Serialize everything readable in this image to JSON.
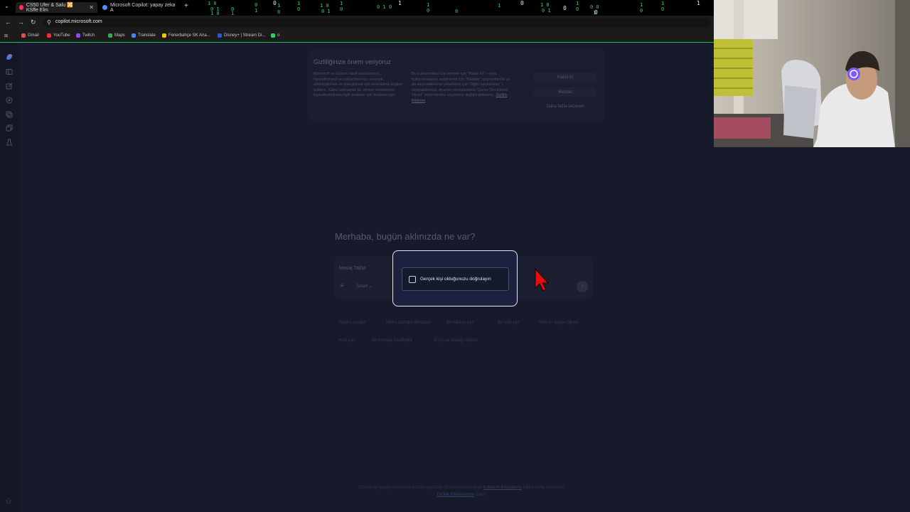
{
  "browser": {
    "tabs": [
      {
        "label": "CS50 Ufer & Salu 🔀 KSffe Elm",
        "active": true,
        "color": "#ff2d55"
      },
      {
        "label": "Microsoft Copilot: yapay zeka A",
        "active": false,
        "color": "#5b8cff"
      }
    ],
    "new_tab_glyph": "+",
    "url": "copilot.microsoft.com",
    "bookmarks": [
      {
        "label": "Gmail",
        "color": "#e54b4b"
      },
      {
        "label": "YouTube",
        "color": "#ff2a2a"
      },
      {
        "label": "Twitch",
        "color": "#9146ff"
      },
      {
        "label": "Maps",
        "color": "#34a853"
      },
      {
        "label": "Translate",
        "color": "#4285f4"
      },
      {
        "label": "Fenerbahçe SK Ana...",
        "color": "#f5c400"
      },
      {
        "label": "Disney+ | Stream Di...",
        "color": "#1f5bd8"
      },
      {
        "label": "o",
        "color": "#25d366"
      }
    ]
  },
  "privacy": {
    "title": "Gizliliğinize önem veriyoruz",
    "col1": "Microsoft ve üçüncü taraf satıcılarımız, hizmetlerimizi ve reklamlarımızı sunmak, etkinleştirmek ve iyileştirmek için tanımlama bilgileri kullanır. Kabul ederseniz bu verileri reklamların kişiselleştirilmesi ilgili analizler için kullanacağız.",
    "col2_text": "Bu kullanımlara izin vermek için \"Kabul Et\" i veya kullanılmalarını reddetmek için \"Reddet\" seçeneklerini ya da seçeneklerinizi yönetmek için \"Diğer seçenekler\" i tıklayabilirsiniz. Ayarlar menüsündeki \"Çerez Tercihlerini Yönet\" bölümünden seçiminizi değiştirebilirsiniz.",
    "col2_link": "Gizlilik Bildirimi",
    "accept": "Kabul et",
    "reject": "Reddet",
    "more": "Daha fazla seçenek"
  },
  "main": {
    "greeting": "Merhaba, bugün aklınızda ne var?",
    "placeholder": "Mesaj Talha",
    "mode": "Smart",
    "verify_label": "Gerçek kişi olduğunuzu doğrulayın"
  },
  "suggestions": [
    "Resim oluştur",
    "Metni taslağa dönüştür",
    "Bir hikaye yaz",
    "Bir kod yaz",
    "Yeni bir şeyler öğren",
    "Kod yaz",
    "Bir konuyu basitleştir",
    "E-posta taslağı oluştur"
  ],
  "footer": {
    "text1": "Copilot bir yapay zekadır ve hatalar yapabilir. Copilot'u kullanarak",
    "link1": "Kullanım Koşulları'nı",
    "text2": "kabul etmiş olursunuz.",
    "link2": "Gizlilik Bildirimimize",
    "text3": "bakın."
  },
  "colors": {
    "accent_green": "#1fbf5a",
    "modal_border": "#e6e6ea",
    "cursor": "#e01010"
  },
  "icons": {
    "sidebar": [
      "copilot-logo-icon",
      "panel-icon",
      "compose-icon",
      "discover-icon",
      "library-icon",
      "collection-icon",
      "labs-icon"
    ],
    "user": "user-icon"
  }
}
